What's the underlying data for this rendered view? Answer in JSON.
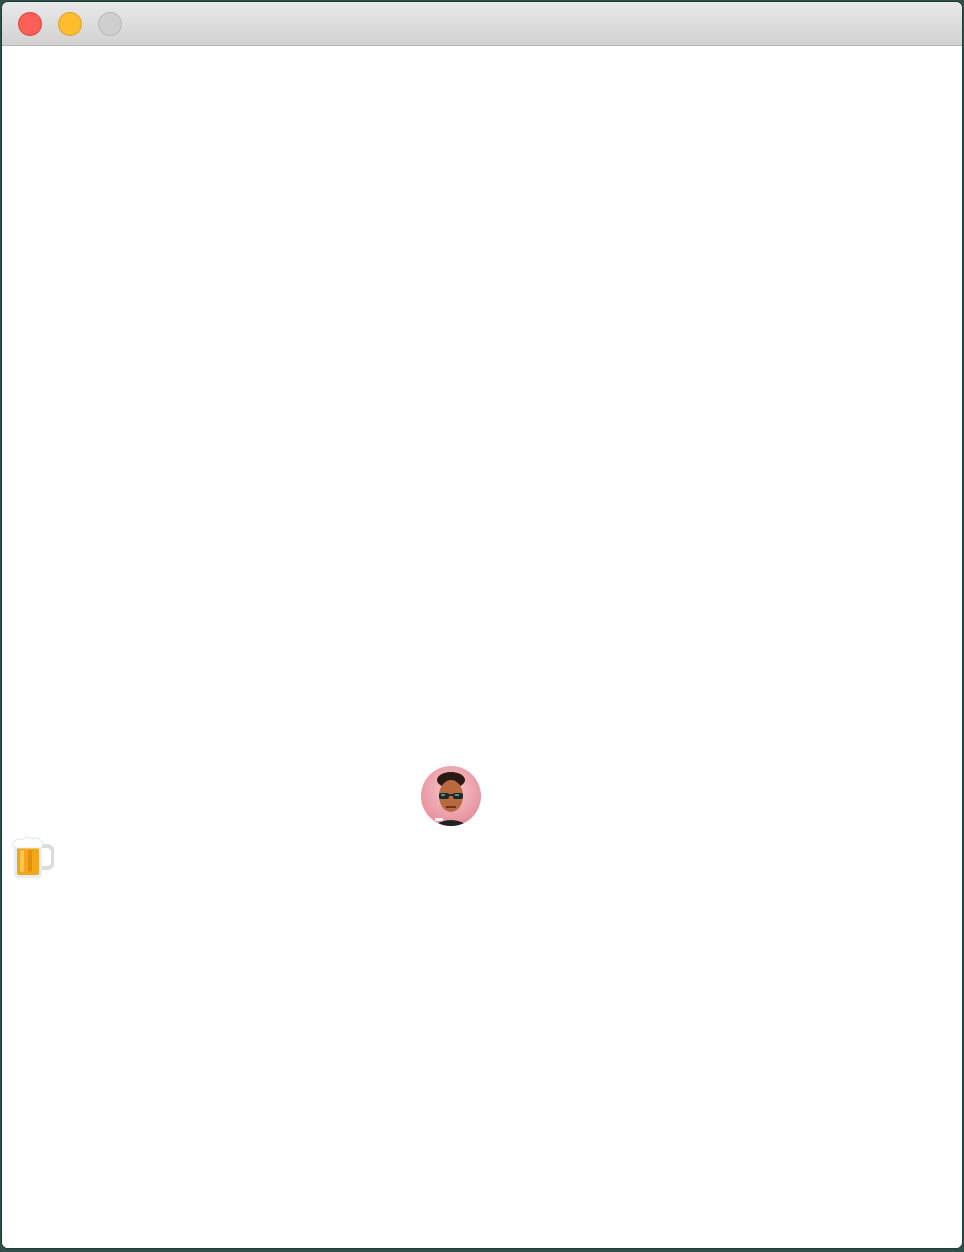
{
  "window": {
    "controls": {
      "close": {
        "icon": "close-traffic-light-icon",
        "color": "#fe5f57"
      },
      "minimize": {
        "icon": "minimize-traffic-light-icon",
        "color": "#febc2e"
      },
      "zoom": {
        "icon": "zoom-traffic-light-icon",
        "color": "#d0cfd0"
      }
    }
  },
  "content": {
    "avatar": {
      "icon": "user-avatar-with-sunglasses"
    },
    "item": {
      "icon": "beer-mug-emoji"
    }
  }
}
